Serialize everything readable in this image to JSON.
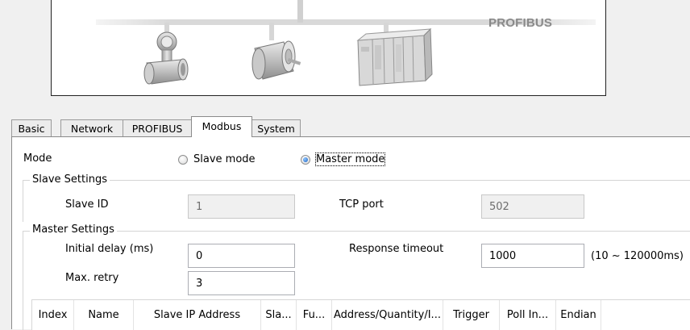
{
  "banner": {
    "label": "PROFIBUS",
    "devices": [
      "flowmeter",
      "motor",
      "plc-rack"
    ]
  },
  "tabs": [
    {
      "label": "Basic",
      "active": false
    },
    {
      "label": "Network",
      "active": false
    },
    {
      "label": "PROFIBUS",
      "active": false
    },
    {
      "label": "Modbus",
      "active": true
    },
    {
      "label": "System",
      "active": false
    }
  ],
  "modbus": {
    "mode_label": "Mode",
    "slave_mode_label": "Slave mode",
    "master_mode_label": "Master mode",
    "selected_mode": "master",
    "slave_settings": {
      "title": "Slave Settings",
      "slave_id_label": "Slave ID",
      "slave_id_value": "1",
      "tcp_port_label": "TCP port",
      "tcp_port_value": "502"
    },
    "master_settings": {
      "title": "Master Settings",
      "initial_delay_label": "Initial delay (ms)",
      "initial_delay_value": "0",
      "response_timeout_label": "Response timeout",
      "response_timeout_value": "1000",
      "response_timeout_range": "(10 ~ 120000ms)",
      "max_retry_label": "Max. retry",
      "max_retry_value": "3"
    },
    "table": {
      "columns": [
        "Index",
        "Name",
        "Slave IP Address",
        "Sla...",
        "Fu...",
        "Address/Quantity/I...",
        "Trigger",
        "Poll In...",
        "Endian"
      ]
    }
  }
}
